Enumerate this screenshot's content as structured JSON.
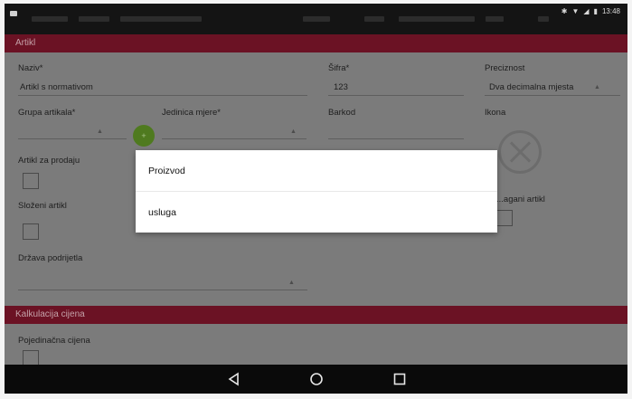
{
  "sections": {
    "artikl": "Artikl",
    "kalkulacija": "Kalkulacija cijena"
  },
  "fields": {
    "naziv_label": "Naziv*",
    "naziv_value": "Artikl s normativom",
    "sifra_label": "Šifra*",
    "sifra_value": "123",
    "preciznost_label": "Preciznost",
    "preciznost_value": "Dva decimalna mjesta",
    "grupa_label": "Grupa artikala*",
    "jedinica_label": "Jedinica mjere*",
    "barkod_label": "Barkod",
    "ikona_label": "Ikona",
    "za_prodaju_label": "Artikl za prodaju",
    "slozeni_label": "Složeni artikl",
    "vagani_label": "...agani artikl",
    "drzava_label": "Država podrijetla",
    "pojedinacna_label": "Pojedinačna cijena"
  },
  "status": {
    "time": "13:48"
  },
  "dialog": {
    "options": [
      "Proizvod",
      "usluga"
    ]
  },
  "colors": {
    "accent": "#a0102e",
    "navbar": "#0a0a0a"
  }
}
